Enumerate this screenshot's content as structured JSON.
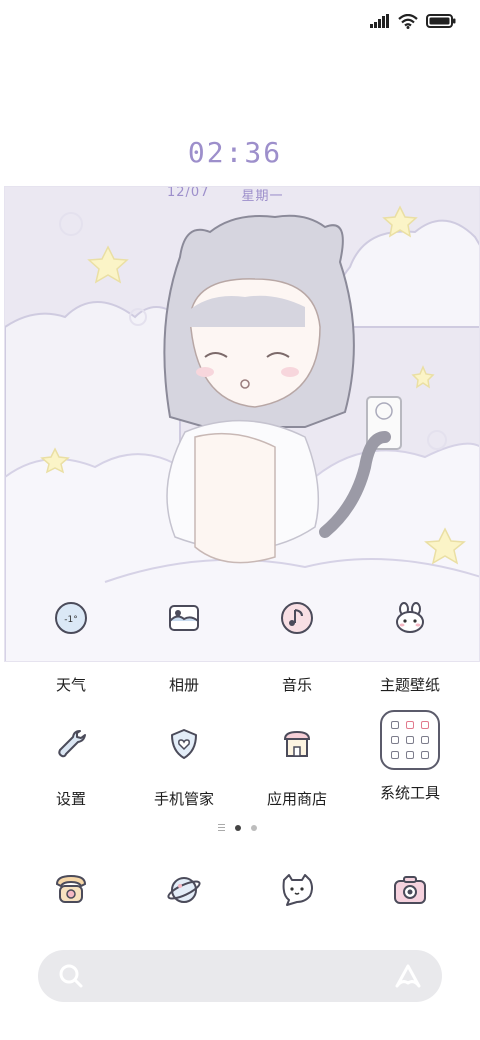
{
  "status_bar": {
    "signal": "signal-icon",
    "wifi": "wifi-icon",
    "battery": "battery-icon"
  },
  "lockclock": {
    "time": "02:36",
    "date": "12/07",
    "weekday": "星期一"
  },
  "apps_row1": [
    {
      "label": "天气",
      "icon": "weather-icon"
    },
    {
      "label": "相册",
      "icon": "gallery-icon"
    },
    {
      "label": "音乐",
      "icon": "music-icon"
    },
    {
      "label": "主题壁纸",
      "icon": "theme-icon"
    }
  ],
  "apps_row2": [
    {
      "label": "设置",
      "icon": "wrench-icon"
    },
    {
      "label": "手机管家",
      "icon": "shield-icon"
    },
    {
      "label": "应用商店",
      "icon": "store-icon"
    },
    {
      "label": "系统工具",
      "icon": "tools-folder-icon"
    }
  ],
  "weather_icon_text": "-1°",
  "page_indicator": {
    "pages": 2,
    "active": 1
  },
  "dock": [
    {
      "icon": "phone-icon"
    },
    {
      "icon": "browser-icon"
    },
    {
      "icon": "messages-icon"
    },
    {
      "icon": "camera-icon"
    }
  ],
  "search": {
    "icon": "search-icon",
    "assistant": "assistant-icon"
  },
  "colors": {
    "accent": "#9d8fcb",
    "wallpaper_bg": "#ebe8f2",
    "search_bg": "#e9e9ec"
  }
}
